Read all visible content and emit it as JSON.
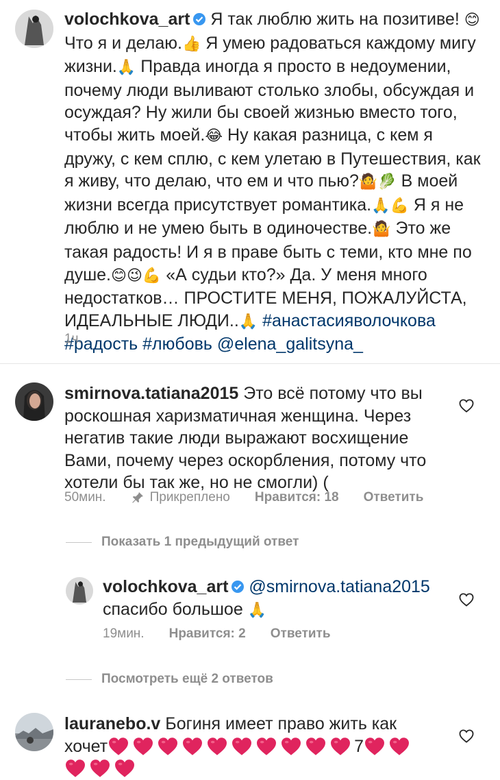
{
  "comments": [
    {
      "username": "volochkova_art",
      "verified": true,
      "text_parts": [
        "Я так люблю жить  на позитиве! ",
        "😊",
        " Что я и делаю.",
        "👍",
        " Я умею радоваться каждому мигу жизни.",
        "🙏",
        " Правда иногда я просто в недоумении, почему люди выливают столько злобы, обсуждая и осуждая? Ну жили бы своей жизнью вместо того, чтобы жить моей.",
        "😂",
        " Ну какая разница, с кем я дружу, с кем сплю, с кем улетаю в Путешествия, как я живу, что делаю, что ем и что пью?",
        "🤷",
        "🥬",
        " В моей жизни всегда присутствует романтика.",
        "🙏",
        "💪",
        " Я я не люблю и не умею быть в одиночестве.",
        "🤷",
        " Это же такая радость! И я в праве быть с теми, кто мне по душе.",
        "😊",
        "😉",
        "💪",
        " «А судьи кто?» Да. У меня много недостатков… ПРОСТИТЕ МЕНЯ, ПОЖАЛУЙСТА, ИДЕАЛЬНЫЕ ЛЮДИ..",
        "🙏"
      ],
      "hashtags": [
        "#анастасияволочкова",
        "#радость",
        "#любовь"
      ],
      "mention": "@elena_galitsyna_",
      "time": "1ч."
    },
    {
      "username": "smirnova.tatiana2015",
      "text": "Это всё потому что вы роскошная харизматичная женщина. Через негатив такие люди выражают восхищение Вами, почему через оскорбления, потому что хотели бы так же, но не смогли) (",
      "time": "50мин.",
      "pinned_label": "Прикреплено",
      "likes_label": "Нравится: 18",
      "reply_label": "Ответить"
    },
    {
      "username": "lauranebo.v",
      "text": "Богиня имеет право жить как хочет",
      "hearts_before_seven": 10,
      "middle_char": "7",
      "hearts_after_seven": 5
    }
  ],
  "show_previous_reply": "Показать 1 предыдущий ответ",
  "reply": {
    "username": "volochkova_art",
    "verified": true,
    "mention": "@smirnova.tatiana2015",
    "text": "спасибо большое ",
    "emoji": "🙏",
    "time": "19мин.",
    "likes_label": "Нравится: 2",
    "reply_label": "Ответить"
  },
  "view_more_replies": "Посмотреть ещё 2 ответов",
  "colors": {
    "text": "#262626",
    "muted": "#8e8e8e",
    "link": "#00376b",
    "verified": "#3897f0",
    "heart_red": "#e0245e"
  },
  "icons": [
    "verified-badge-icon",
    "pin-icon",
    "heart-outline-icon",
    "red-heart-emoji-icon"
  ]
}
